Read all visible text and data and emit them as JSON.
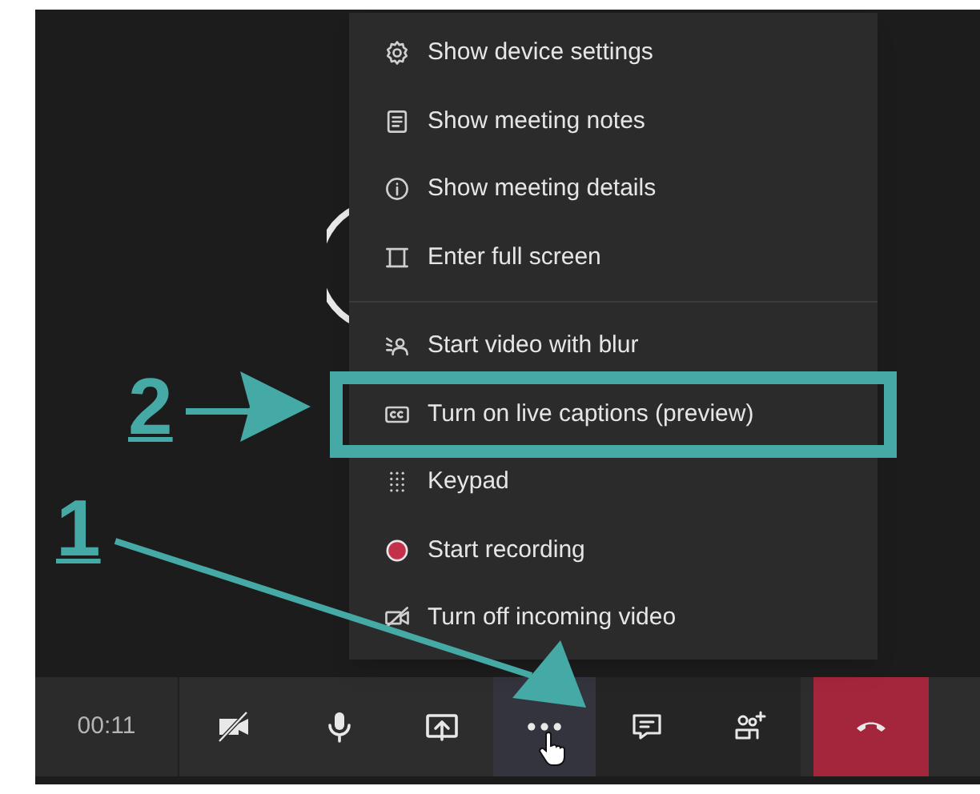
{
  "menu": {
    "sections": [
      {
        "items": [
          {
            "label": "Show device settings",
            "annotated": false
          },
          {
            "label": "Show meeting notes",
            "annotated": false
          },
          {
            "label": "Show meeting details",
            "annotated": false
          },
          {
            "label": "Enter full screen",
            "annotated": false
          }
        ]
      },
      {
        "items": [
          {
            "label": "Start video with blur",
            "annotated": false
          },
          {
            "label": "Turn on live captions (preview)",
            "annotated": true
          },
          {
            "label": "Keypad",
            "annotated": false
          },
          {
            "label": "Start recording",
            "annotated": false
          },
          {
            "label": "Turn off incoming video",
            "annotated": false
          }
        ]
      }
    ]
  },
  "toolbar": {
    "time": "00:11",
    "buttons": [
      {
        "kind": "camera",
        "selected": false
      },
      {
        "kind": "mic",
        "selected": false
      },
      {
        "kind": "share",
        "selected": false
      },
      {
        "kind": "more",
        "selected": true
      },
      {
        "kind": "chat",
        "selected": false
      },
      {
        "kind": "people",
        "selected": false
      },
      {
        "kind": "hangup",
        "selected": false
      }
    ]
  },
  "annotations": [
    {
      "number": "1"
    },
    {
      "number": "2"
    }
  ]
}
